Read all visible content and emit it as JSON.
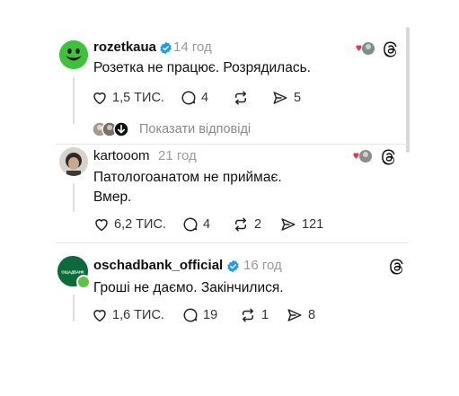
{
  "posts": [
    {
      "username": "rozetkaua",
      "time": "14 год",
      "text": "Розетка не працює. Розрядилась.",
      "likes": "1,5 ТИС.",
      "comments": "4",
      "reposts": "",
      "shares": "5"
    },
    {
      "username": "kartooom",
      "time": "21 год",
      "text_line1": "Патологоанатом не приймає.",
      "text_line2": "Вмер.",
      "likes": "6,2 ТИС.",
      "comments": "4",
      "reposts": "2",
      "shares": "121"
    },
    {
      "username": "oschadbank_official",
      "time": "16 год",
      "text": "Гроші не даємо. Закінчилися.",
      "likes": "1,6 ТИС.",
      "comments": "19",
      "reposts": "1",
      "shares": "8",
      "avatar_text": "ОЩАДБАНК"
    }
  ],
  "show_replies": "Показати відповіді",
  "colors": {
    "verified": "#1d9bf0",
    "rozetka_green": "#3ec23a",
    "oschad_green": "#0c6b3b",
    "online_dot": "#5ac43e",
    "heart_red": "#e8364b"
  },
  "icons": [
    "verified-icon",
    "heart-icon",
    "comment-icon",
    "repost-icon",
    "share-icon",
    "threads-logo-icon",
    "arrow-down-icon"
  ]
}
